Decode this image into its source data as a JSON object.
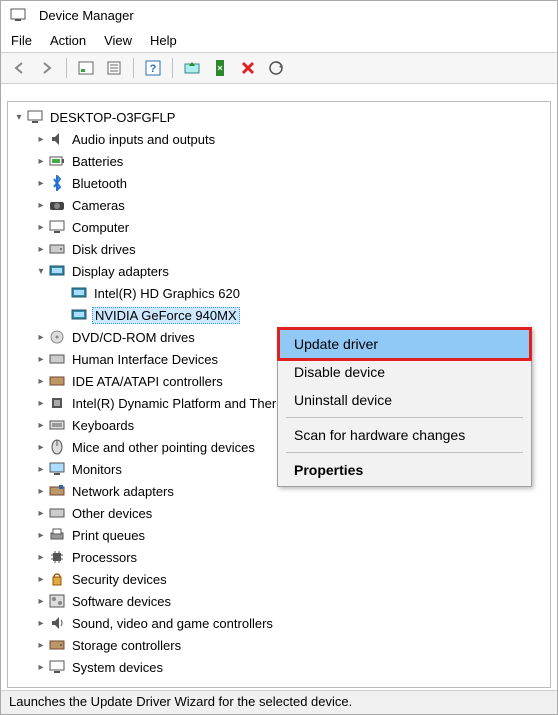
{
  "window": {
    "title": "Device Manager",
    "status": "Launches the Update Driver Wizard for the selected device."
  },
  "menu": {
    "file": "File",
    "action": "Action",
    "view": "View",
    "help": "Help"
  },
  "tree": {
    "root": "DESKTOP-O3FGFLP",
    "items": [
      "Audio inputs and outputs",
      "Batteries",
      "Bluetooth",
      "Cameras",
      "Computer",
      "Disk drives",
      "Display adapters",
      "DVD/CD-ROM drives",
      "Human Interface Devices",
      "IDE ATA/ATAPI controllers",
      "Intel(R) Dynamic Platform and Thermal Framework",
      "Keyboards",
      "Mice and other pointing devices",
      "Monitors",
      "Network adapters",
      "Other devices",
      "Print queues",
      "Processors",
      "Security devices",
      "Software devices",
      "Sound, video and game controllers",
      "Storage controllers",
      "System devices"
    ],
    "display_children": [
      "Intel(R) HD Graphics 620",
      "NVIDIA GeForce 940MX"
    ],
    "selected": "NVIDIA GeForce 940MX"
  },
  "context": {
    "update": "Update driver",
    "disable": "Disable device",
    "uninstall": "Uninstall device",
    "scan": "Scan for hardware changes",
    "properties": "Properties"
  },
  "icons": {
    "app": "devmgr-icon",
    "back": "arrow-left-icon",
    "forward": "arrow-right-icon",
    "showall": "show-hidden-icon",
    "props": "properties-icon",
    "help": "help-icon",
    "update": "update-driver-icon",
    "enable": "enable-device-icon",
    "remove": "remove-icon",
    "scan": "scan-icon"
  }
}
